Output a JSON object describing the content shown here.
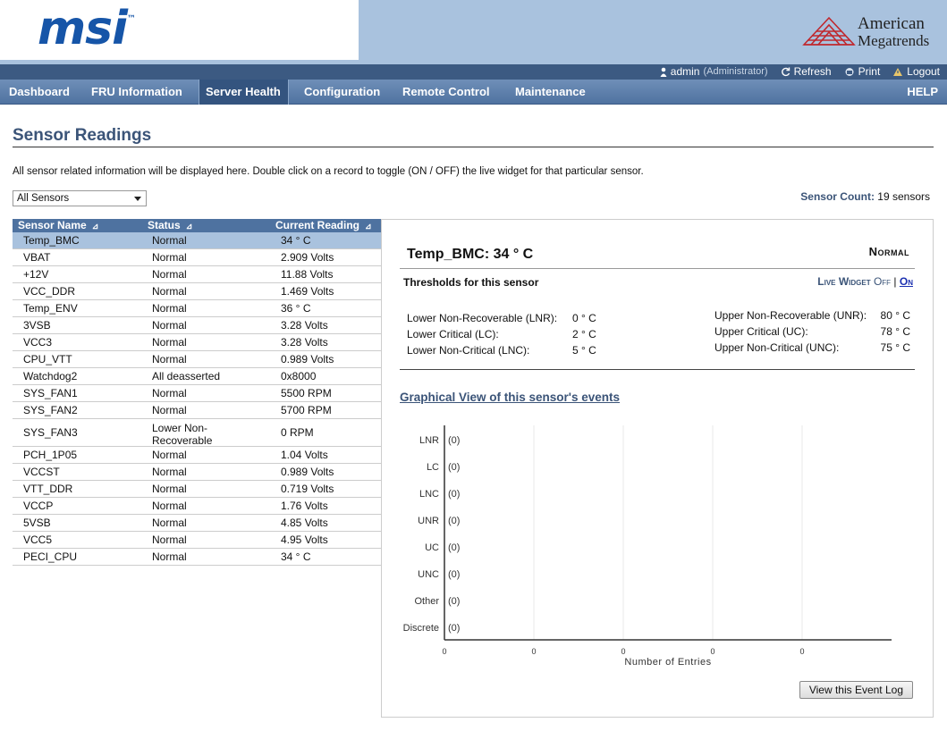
{
  "header": {
    "brand_logo_text": "msi",
    "brand_tm": "™",
    "vendor_line1": "American",
    "vendor_line2": "Megatrends"
  },
  "utility": {
    "user": "admin",
    "role": "(Administrator)",
    "refresh": "Refresh",
    "print": "Print",
    "logout": "Logout"
  },
  "nav": {
    "tabs": [
      {
        "label": "Dashboard"
      },
      {
        "label": "FRU Information"
      },
      {
        "label": "Server Health"
      },
      {
        "label": "Configuration"
      },
      {
        "label": "Remote Control"
      },
      {
        "label": "Maintenance"
      }
    ],
    "active_tab": "Server Health",
    "help": "HELP"
  },
  "page": {
    "title": "Sensor Readings",
    "description": "All sensor related information will be displayed here. Double click on a record to toggle (ON / OFF) the live widget for that particular sensor.",
    "filter_selected": "All Sensors",
    "sensor_count_label": "Sensor Count:",
    "sensor_count_value": "19 sensors"
  },
  "table": {
    "columns": [
      "Sensor Name",
      "Status",
      "Current Reading"
    ],
    "sort_glyph": "⊿",
    "selected_index": 0,
    "rows": [
      {
        "name": "Temp_BMC",
        "status": "Normal",
        "reading": "34 ° C"
      },
      {
        "name": "VBAT",
        "status": "Normal",
        "reading": "2.909 Volts"
      },
      {
        "name": "+12V",
        "status": "Normal",
        "reading": "11.88 Volts"
      },
      {
        "name": "VCC_DDR",
        "status": "Normal",
        "reading": "1.469 Volts"
      },
      {
        "name": "Temp_ENV",
        "status": "Normal",
        "reading": "36 ° C"
      },
      {
        "name": "3VSB",
        "status": "Normal",
        "reading": "3.28 Volts"
      },
      {
        "name": "VCC3",
        "status": "Normal",
        "reading": "3.28 Volts"
      },
      {
        "name": "CPU_VTT",
        "status": "Normal",
        "reading": "0.989 Volts"
      },
      {
        "name": "Watchdog2",
        "status": "All deasserted",
        "reading": "0x8000"
      },
      {
        "name": "SYS_FAN1",
        "status": "Normal",
        "reading": "5500 RPM"
      },
      {
        "name": "SYS_FAN2",
        "status": "Normal",
        "reading": "5700 RPM"
      },
      {
        "name": "SYS_FAN3",
        "status": "Lower Non-Recoverable",
        "reading": "0 RPM",
        "tall": true
      },
      {
        "name": "PCH_1P05",
        "status": "Normal",
        "reading": "1.04 Volts"
      },
      {
        "name": "VCCST",
        "status": "Normal",
        "reading": "0.989 Volts"
      },
      {
        "name": "VTT_DDR",
        "status": "Normal",
        "reading": "0.719 Volts"
      },
      {
        "name": "VCCP",
        "status": "Normal",
        "reading": "1.76 Volts"
      },
      {
        "name": "5VSB",
        "status": "Normal",
        "reading": "4.85 Volts"
      },
      {
        "name": "VCC5",
        "status": "Normal",
        "reading": "4.95 Volts"
      },
      {
        "name": "PECI_CPU",
        "status": "Normal",
        "reading": "34 ° C"
      }
    ]
  },
  "detail": {
    "sensor_heading": "Temp_BMC: 34 ° C",
    "status": "Normal",
    "thresholds_label": "Thresholds for this sensor",
    "live_widget_label": "Live Widget",
    "live_off": "Off",
    "live_sep": "|",
    "live_on": "On",
    "thresholds_left": [
      {
        "label": "Lower Non-Recoverable (LNR):",
        "value": "0 ° C"
      },
      {
        "label": "Lower Critical (LC):",
        "value": "2 ° C"
      },
      {
        "label": "Lower Non-Critical (LNC):",
        "value": "5 ° C"
      }
    ],
    "thresholds_right": [
      {
        "label": "Upper Non-Recoverable (UNR):",
        "value": "80 ° C"
      },
      {
        "label": "Upper Critical (UC):",
        "value": "78 ° C"
      },
      {
        "label": "Upper Non-Critical (UNC):",
        "value": "75 ° C"
      }
    ],
    "graph_title": "Graphical View of this sensor's events",
    "event_log_button": "View this Event Log"
  },
  "colors": {
    "header_bg": "#a9c2de",
    "util_bg": "#3c5a82",
    "nav_bg": "#4f72a0",
    "accent_text": "#3b5478",
    "selected_row": "#a9c2de",
    "brand_blue": "#1655a8",
    "ami_red": "#c0272d"
  },
  "chart_data": {
    "type": "bar",
    "orientation": "horizontal",
    "categories": [
      "LNR",
      "LC",
      "LNC",
      "UNR",
      "UC",
      "UNC",
      "Other",
      "Discrete"
    ],
    "values": [
      0,
      0,
      0,
      0,
      0,
      0,
      0,
      0
    ],
    "value_labels": [
      "(0)",
      "(0)",
      "(0)",
      "(0)",
      "(0)",
      "(0)",
      "(0)",
      "(0)"
    ],
    "x_ticks": [
      "0",
      "0",
      "0",
      "0",
      "0"
    ],
    "xlabel": "Number of Entries",
    "ylabel": "",
    "grid": true
  }
}
